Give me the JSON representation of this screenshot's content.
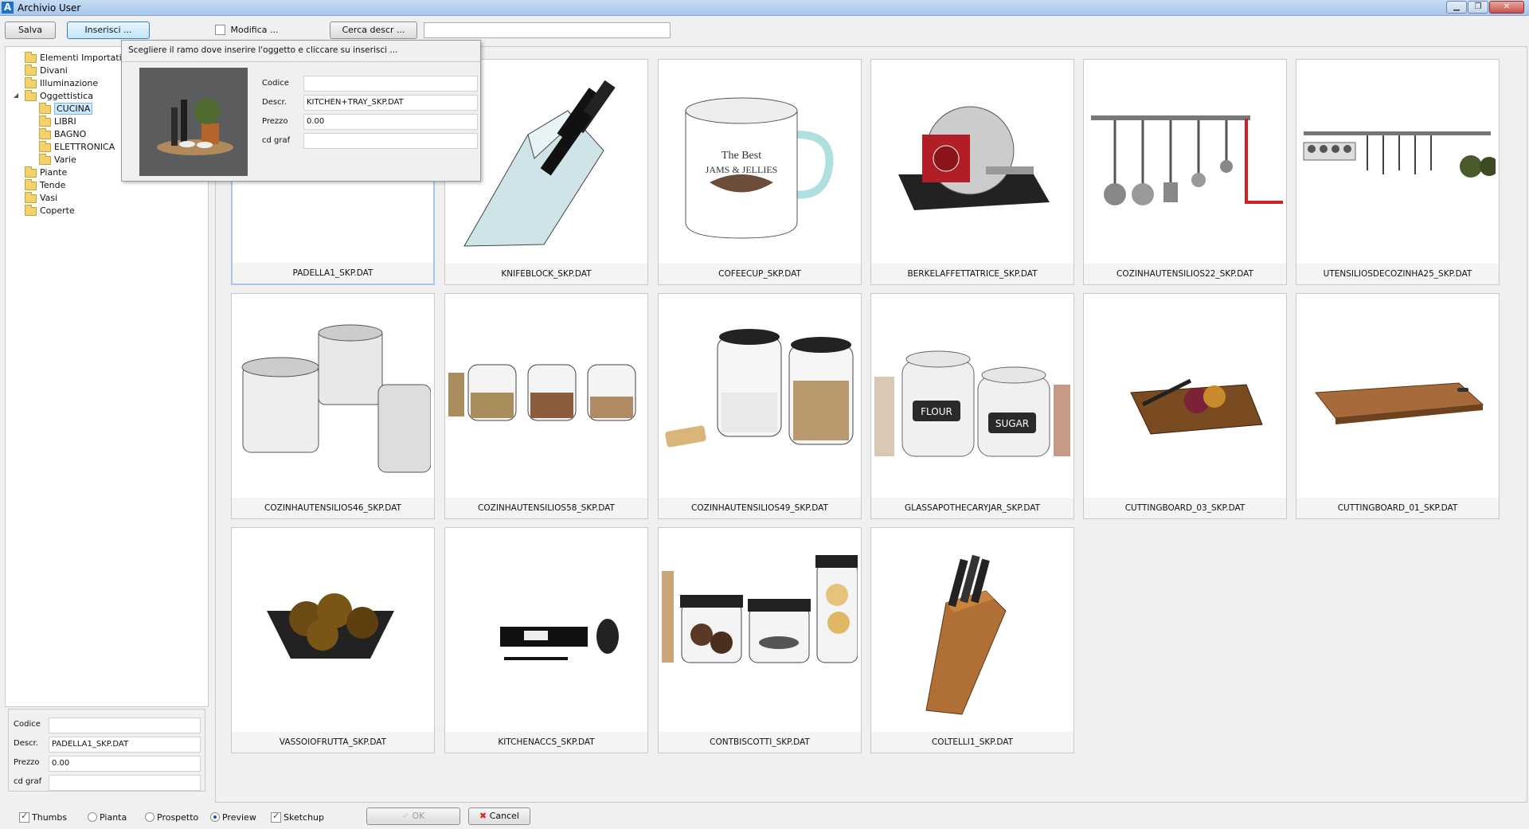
{
  "window": {
    "title": "Archivio User",
    "app_icon_letter": "A"
  },
  "toolbar": {
    "save_label": "Salva",
    "insert_label": "Inserisci ...",
    "modify_label": "Modifica ...",
    "search_label": "Cerca descr ...",
    "search_value": ""
  },
  "popup": {
    "hint": "Scegliere il ramo dove inserire l'oggetto e cliccare su inserisci ...",
    "codice_label": "Codice",
    "codice_value": "",
    "descr_label": "Descr.",
    "descr_value": "KITCHEN+TRAY_SKP.DAT",
    "prezzo_label": "Prezzo",
    "prezzo_value": "0.00",
    "cdgraf_label": "cd graf",
    "cdgraf_value": ""
  },
  "tree": {
    "items": [
      {
        "label": "Elementi Importati",
        "level": 0
      },
      {
        "label": "Divani",
        "level": 0
      },
      {
        "label": "Illuminazione",
        "level": 0
      },
      {
        "label": "Oggettistica",
        "level": 0,
        "expanded": true
      },
      {
        "label": "CUCINA",
        "level": 1,
        "selected": true
      },
      {
        "label": "LIBRI",
        "level": 1
      },
      {
        "label": "BAGNO",
        "level": 1
      },
      {
        "label": "ELETTRONICA",
        "level": 1
      },
      {
        "label": "Varie",
        "level": 1
      },
      {
        "label": "Piante",
        "level": 0
      },
      {
        "label": "Tende",
        "level": 0
      },
      {
        "label": "Vasi",
        "level": 0
      },
      {
        "label": "Coperte",
        "level": 0
      }
    ]
  },
  "info": {
    "codice_label": "Codice",
    "codice_value": "",
    "descr_label": "Descr.",
    "descr_value": "PADELLA1_SKP.DAT",
    "prezzo_label": "Prezzo",
    "prezzo_value": "0.00",
    "cdgraf_label": "cd graf",
    "cdgraf_value": ""
  },
  "cards": [
    {
      "name": "PADELLA1_SKP.DAT",
      "icon": "pan"
    },
    {
      "name": "KNIFEBLOCK_SKP.DAT",
      "icon": "knife-block"
    },
    {
      "name": "COFEECUP_SKP.DAT",
      "icon": "mug"
    },
    {
      "name": "BERKELAFFETTATRICE_SKP.DAT",
      "icon": "slicer"
    },
    {
      "name": "COZINHAUTENSILIOS22_SKP.DAT",
      "icon": "utensil-rail"
    },
    {
      "name": "UTENSILIOSDECOZINHA25_SKP.DAT",
      "icon": "utensil-rail-2"
    },
    {
      "name": "COZINHAUTENSILIOS46_SKP.DAT",
      "icon": "jars"
    },
    {
      "name": "COZINHAUTENSILIOS58_SKP.DAT",
      "icon": "spice-jars"
    },
    {
      "name": "COZINHAUTENSILIOS49_SKP.DAT",
      "icon": "storage-jars"
    },
    {
      "name": "GLASSAPOTHECARYJAR_SKP.DAT",
      "icon": "apothecary-jars"
    },
    {
      "name": "CUTTINGBOARD_03_SKP.DAT",
      "icon": "cutting-board-food"
    },
    {
      "name": "CUTTINGBOARD_01_SKP.DAT",
      "icon": "cutting-board"
    },
    {
      "name": "VASSOIOFRUTTA_SKP.DAT",
      "icon": "fruit-bowl"
    },
    {
      "name": "KITCHENACCS_SKP.DAT",
      "icon": "kitchen-accessories"
    },
    {
      "name": "CONTBISCOTTI_SKP.DAT",
      "icon": "biscuit-jars"
    },
    {
      "name": "COLTELLI1_SKP.DAT",
      "icon": "wood-knife-block"
    }
  ],
  "jar_labels": {
    "flour": "FLOUR",
    "sugar": "SUGAR",
    "mug_text_1": "The Best",
    "mug_text_2": "JAMS & JELLIES"
  },
  "bottom": {
    "thumbs_label": "Thumbs",
    "pianta_label": "Pianta",
    "prospetto_label": "Prospetto",
    "preview_label": "Preview",
    "sketchup_label": "Sketchup",
    "ok_label": "OK",
    "cancel_label": "Cancel"
  }
}
